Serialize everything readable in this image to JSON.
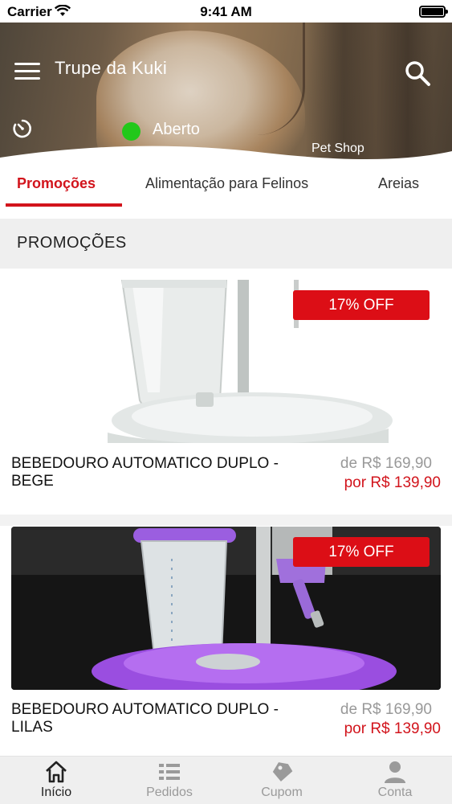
{
  "status_bar": {
    "carrier": "Carrier",
    "time": "9:41 AM"
  },
  "header": {
    "store_name": "Trupe da Kuki",
    "status": "Aberto",
    "status_color": "#22c81a",
    "category": "Pet Shop",
    "icons": [
      "menu-icon",
      "search-icon",
      "timer-icon"
    ]
  },
  "tabs": [
    {
      "label": "Promoções",
      "active": true
    },
    {
      "label": "Alimentação para Felinos",
      "active": false
    },
    {
      "label": "Areias",
      "active": false
    }
  ],
  "section": {
    "title": "PROMOÇÕES"
  },
  "products": [
    {
      "name": "BEBEDOURO AUTOMATICO DUPLO - BEGE",
      "badge": "17% OFF",
      "old_price": "de R$ 169,90",
      "new_price": "por R$ 139,90",
      "image_color": "beige"
    },
    {
      "name": "BEBEDOURO AUTOMATICO DUPLO - LILAS",
      "badge": "17% OFF",
      "old_price": "de R$ 169,90",
      "new_price": "por R$ 139,90",
      "image_color": "lilac"
    }
  ],
  "bottom_nav": [
    {
      "label": "Início",
      "icon": "home-icon",
      "active": true
    },
    {
      "label": "Pedidos",
      "icon": "list-icon",
      "active": false
    },
    {
      "label": "Cupom",
      "icon": "tag-icon",
      "active": false
    },
    {
      "label": "Conta",
      "icon": "user-icon",
      "active": false
    }
  ],
  "colors": {
    "accent": "#d2141c",
    "badge": "#dc0e16",
    "open": "#22c81a"
  }
}
